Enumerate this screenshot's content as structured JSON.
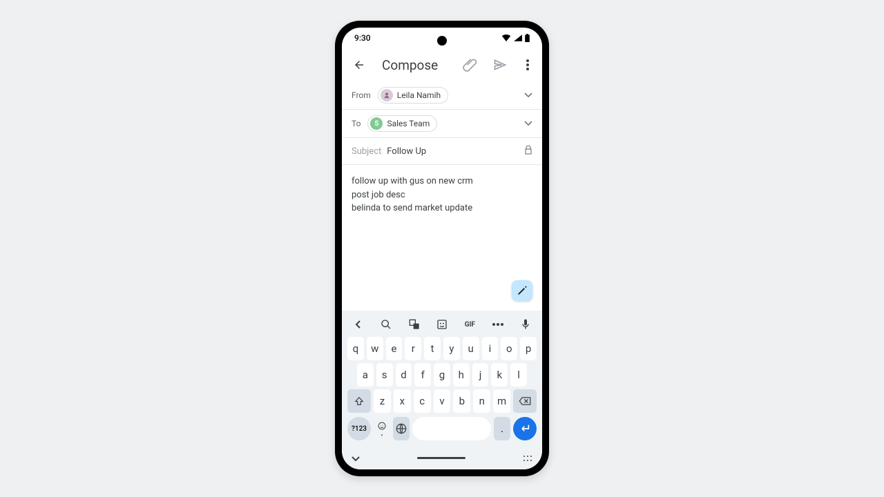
{
  "status": {
    "time": "9:30"
  },
  "appbar": {
    "title": "Compose"
  },
  "from": {
    "label": "From",
    "name": "Leila Namih"
  },
  "to": {
    "label": "To",
    "name": "Sales Team",
    "initial": "S"
  },
  "subject": {
    "label": "Subject",
    "value": "Follow Up"
  },
  "body": {
    "l1": "follow up with gus on new crm",
    "l2": "post job desc",
    "l3": "belinda to send market update"
  },
  "kb": {
    "gif": "GIF",
    "r1": [
      "q",
      "w",
      "e",
      "r",
      "t",
      "y",
      "u",
      "i",
      "o",
      "p"
    ],
    "r2": [
      "a",
      "s",
      "d",
      "f",
      "g",
      "h",
      "j",
      "k",
      "l"
    ],
    "r3": [
      "z",
      "x",
      "c",
      "v",
      "b",
      "n",
      "m"
    ],
    "num": "?123",
    "comma": ",",
    "dot": "."
  }
}
